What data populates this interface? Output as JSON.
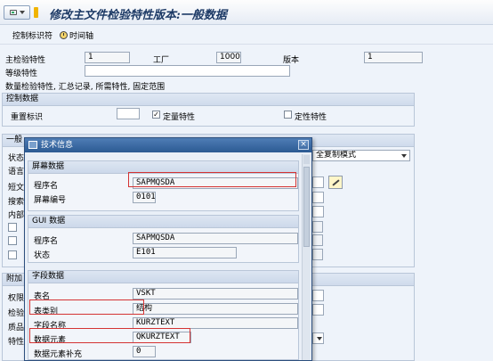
{
  "window": {
    "title": "修改主文件检验特性版本:一般数据"
  },
  "toolbar": {
    "control_indicator": "控制标识符",
    "timeline": "时间轴"
  },
  "header": {
    "master_char_label": "主检验特性",
    "master_char_value": "1",
    "plant_label": "工厂",
    "plant_value": "1000",
    "version_label": "版本",
    "version_value": "1",
    "class_char_label": "等级特性",
    "class_char_value": "",
    "summary_text": "数量检验特性, 汇总记录, 所需特性, 固定范围"
  },
  "control": {
    "title": "控制数据",
    "reset_label": "重置标识",
    "reset_value": "",
    "quant_label": "定量特性",
    "quant_checked": "✓",
    "qual_label": "定性特性"
  },
  "general": {
    "title": "一般",
    "status_label": "状态",
    "lang_label": "语言",
    "short_label": "短文",
    "search_label": "搜索",
    "inner_label": "内部",
    "copy_mode": "全复制模式"
  },
  "additional": {
    "title": "附加",
    "auth_label": "权限",
    "check_label": "检验",
    "sample_label": "质品",
    "special_label": "特性"
  },
  "dialog": {
    "title": "技术信息",
    "close": "×",
    "screen": {
      "title": "屏幕数据",
      "program_label": "程序名",
      "program_value": "SAPMQSDA",
      "screen_no_label": "屏幕编号",
      "screen_no_value": "0101"
    },
    "gui": {
      "title": "GUI 数据",
      "program_label": "程序名",
      "program_value": "SAPMQSDA",
      "status_label": "状态",
      "status_value": "E101"
    },
    "field": {
      "title": "字段数据",
      "table_label": "表名",
      "table_value": "VSKT",
      "table_type_label": "表类别",
      "table_type_value": "结构",
      "field_name_label": "字段名称",
      "field_name_value": "KURZTEXT",
      "data_element_label": "数据元素",
      "data_element_value": "QKURZTEXT",
      "data_element_supp_label": "数据元素补充",
      "data_element_supp_value": "0"
    }
  }
}
